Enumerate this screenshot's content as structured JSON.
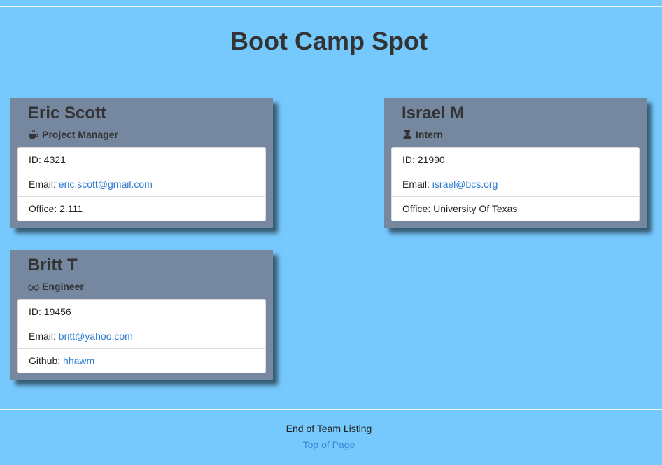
{
  "header": {
    "title": "Boot Camp Spot"
  },
  "cards": [
    {
      "name": "Eric Scott",
      "role": "Project Manager",
      "role_icon": "coffee-icon",
      "id_label": "ID: 4321",
      "email_label": "Email: ",
      "email": "eric.scott@gmail.com",
      "extra_label": "Office: 2.111"
    },
    {
      "name": "Israel M",
      "role": "Intern",
      "role_icon": "graduate-icon",
      "id_label": "ID: 21990",
      "email_label": "Email: ",
      "email": "israel@bcs.org",
      "extra_label": "Office: University Of Texas"
    },
    {
      "name": "Britt T",
      "role": "Engineer",
      "role_icon": "glasses-icon",
      "id_label": "ID: 19456",
      "email_label": "Email: ",
      "email": "britt@yahoo.com",
      "extra_label": "Github: ",
      "github": "hhawm"
    }
  ],
  "footer": {
    "text": "End of Team Listing",
    "link": "Top of Page"
  },
  "colors": {
    "background": "#76c9fd",
    "card": "#7588a0",
    "link": "#2a7ad0"
  }
}
